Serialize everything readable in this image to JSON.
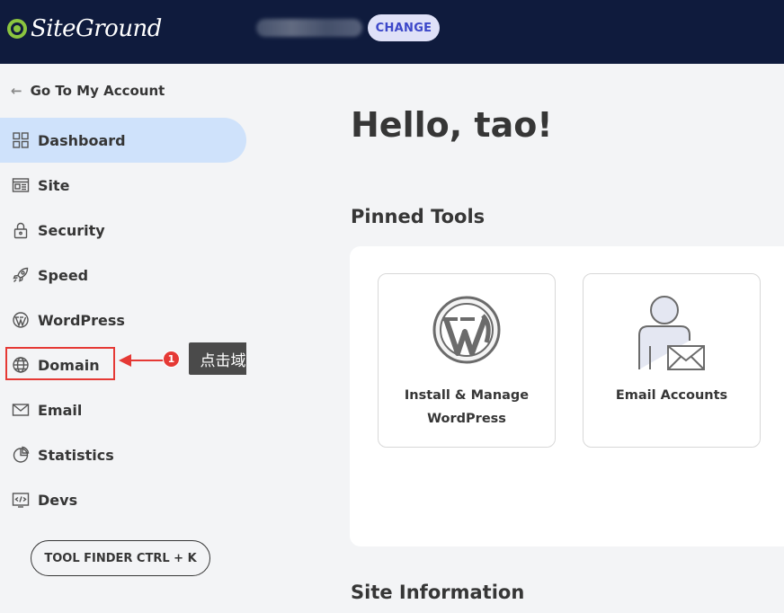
{
  "header": {
    "logo_text": "SiteGround",
    "change_label": "CHANGE"
  },
  "sidebar": {
    "back_label": "Go To My Account",
    "items": [
      {
        "label": "Dashboard",
        "icon": "grid-icon",
        "active": true
      },
      {
        "label": "Site",
        "icon": "site-icon"
      },
      {
        "label": "Security",
        "icon": "lock-icon"
      },
      {
        "label": "Speed",
        "icon": "rocket-icon"
      },
      {
        "label": "WordPress",
        "icon": "wordpress-icon"
      },
      {
        "label": "Domain",
        "icon": "globe-icon"
      },
      {
        "label": "Email",
        "icon": "envelope-icon"
      },
      {
        "label": "Statistics",
        "icon": "pie-chart-icon"
      },
      {
        "label": "Devs",
        "icon": "code-icon"
      }
    ],
    "tool_finder_label": "TOOL FINDER CTRL + K"
  },
  "annotation": {
    "step_number": "1",
    "label": "点击域名"
  },
  "main": {
    "greeting": "Hello, tao!",
    "pinned_title": "Pinned Tools",
    "tools": [
      {
        "label_line1": "Install & Manage",
        "label_line2": "WordPress",
        "icon": "wordpress-logo-icon"
      },
      {
        "label_line1": "Email Accounts",
        "label_line2": "",
        "icon": "email-accounts-icon"
      }
    ],
    "site_info_title": "Site Information"
  },
  "colors": {
    "header_bg": "#0f1b3d",
    "accent_green": "#8bc53f",
    "active_nav_bg": "#cfe2fb",
    "change_text": "#3c47c9",
    "annotation_red": "#e53935"
  }
}
